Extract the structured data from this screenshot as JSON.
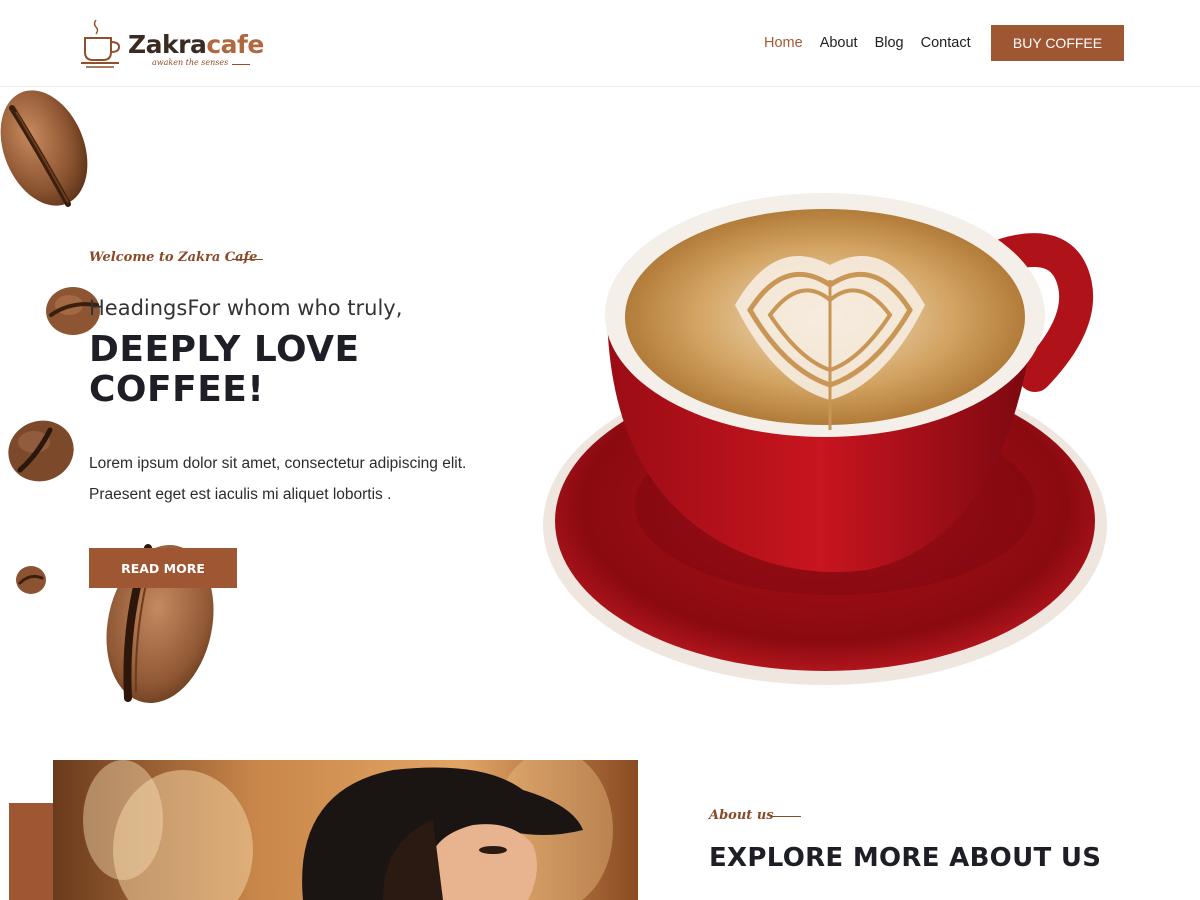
{
  "brand": {
    "name_part1": "Zakra",
    "name_part2": "cafe",
    "tagline": "awaken the senses",
    "colors": {
      "accent": "#9e5633",
      "dark": "#1e1f26",
      "brown_text": "#8a4a2a"
    }
  },
  "nav": {
    "items": [
      {
        "label": "Home",
        "active": true
      },
      {
        "label": "About",
        "active": false
      },
      {
        "label": "Blog",
        "active": false
      },
      {
        "label": "Contact",
        "active": false
      }
    ],
    "cta_label": "BUY COFFEE"
  },
  "hero": {
    "welcome": "Welcome to Zakra Cafe",
    "subheading": "HeadingsFor whom who truly,",
    "heading": "DEEPLY LOVE COFFEE!",
    "text": "Lorem ipsum dolor sit amet, consectetur adipiscing elit. Praesent eget est iaculis mi aliquet lobortis .",
    "button_label": "READ MORE"
  },
  "about": {
    "label": "About us",
    "title": "EXPLORE MORE ABOUT US"
  }
}
